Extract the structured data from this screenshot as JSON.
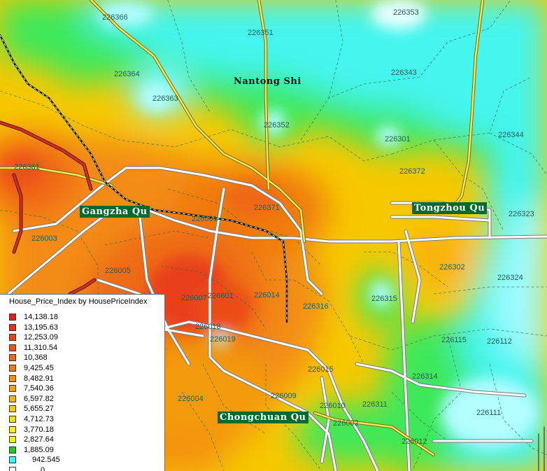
{
  "legend": {
    "title": "House_Price_Index by HousePriceIndex",
    "items": [
      {
        "label": "14,138.18",
        "color": "#e81c1c"
      },
      {
        "label": "13,195.63",
        "color": "#ea2f18"
      },
      {
        "label": "12,253.09",
        "color": "#ec4216"
      },
      {
        "label": "11,310.54",
        "color": "#ee5514"
      },
      {
        "label": "10,368",
        "color": "#f06812"
      },
      {
        "label": "9,425.45",
        "color": "#f47a10"
      },
      {
        "label": "8,482.91",
        "color": "#f78e0c"
      },
      {
        "label": "7,540.36",
        "color": "#faa00a"
      },
      {
        "label": "6,597.82",
        "color": "#fcb408"
      },
      {
        "label": "5,655.27",
        "color": "#fdc806"
      },
      {
        "label": "4,712.73",
        "color": "#fedc04"
      },
      {
        "label": "3,770.18",
        "color": "#ffee02"
      },
      {
        "label": "2,827.64",
        "color": "#f0f500"
      },
      {
        "label": "1,885.09",
        "color": "#22cc22"
      },
      {
        "label": "942.545",
        "color": "#33ffff"
      },
      {
        "label": "0",
        "color": "#ffffff"
      }
    ]
  },
  "districts": {
    "nantong": "Nantong Shi",
    "gangzha": "Gangzha Qu",
    "tongzhou": "Tongzhou Qu",
    "chongchuan": "Chongchuan Qu"
  },
  "postcodes": [
    "226366",
    "226351",
    "226353",
    "226364",
    "226363",
    "226343",
    "226352",
    "226301",
    "226344",
    "226361",
    "226372",
    "226371",
    "226001",
    "226323",
    "226003",
    "226005",
    "226302",
    "226324",
    "226007",
    "226601",
    "226014",
    "226315",
    "226316",
    "226018",
    "226019",
    "226115",
    "226112",
    "226015",
    "226314",
    "226009",
    "226004",
    "226010",
    "226311",
    "226111",
    "226002",
    "226012"
  ]
}
